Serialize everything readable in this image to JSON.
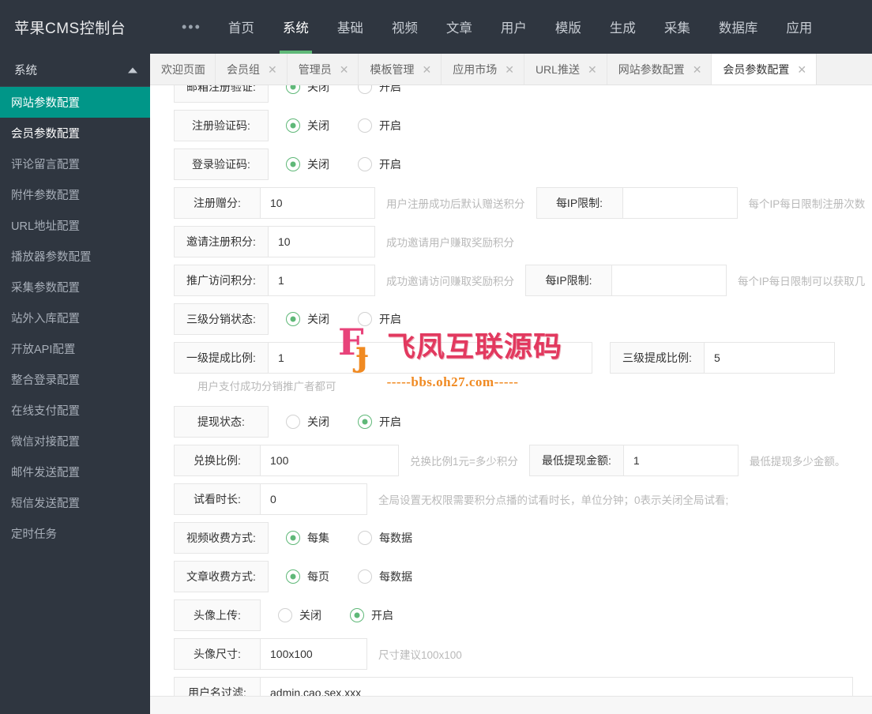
{
  "header": {
    "brand": "苹果CMS控制台",
    "dots": "•••",
    "nav": [
      {
        "label": "首页",
        "active": false
      },
      {
        "label": "系统",
        "active": true
      },
      {
        "label": "基础",
        "active": false
      },
      {
        "label": "视频",
        "active": false
      },
      {
        "label": "文章",
        "active": false
      },
      {
        "label": "用户",
        "active": false
      },
      {
        "label": "模版",
        "active": false
      },
      {
        "label": "生成",
        "active": false
      },
      {
        "label": "采集",
        "active": false
      },
      {
        "label": "数据库",
        "active": false
      },
      {
        "label": "应用",
        "active": false
      }
    ]
  },
  "sidebar": {
    "group_label": "系统",
    "items": [
      {
        "label": "网站参数配置",
        "active": true
      },
      {
        "label": "会员参数配置",
        "active": false,
        "hovered": true
      },
      {
        "label": "评论留言配置",
        "active": false
      },
      {
        "label": "附件参数配置",
        "active": false
      },
      {
        "label": "URL地址配置",
        "active": false
      },
      {
        "label": "播放器参数配置",
        "active": false
      },
      {
        "label": "采集参数配置",
        "active": false
      },
      {
        "label": "站外入库配置",
        "active": false
      },
      {
        "label": "开放API配置",
        "active": false
      },
      {
        "label": "整合登录配置",
        "active": false
      },
      {
        "label": "在线支付配置",
        "active": false
      },
      {
        "label": "微信对接配置",
        "active": false
      },
      {
        "label": "邮件发送配置",
        "active": false
      },
      {
        "label": "短信发送配置",
        "active": false
      },
      {
        "label": "定时任务",
        "active": false
      }
    ]
  },
  "tabs": [
    {
      "label": "欢迎页面",
      "closable": false,
      "active": false
    },
    {
      "label": "会员组",
      "closable": true,
      "active": false
    },
    {
      "label": "管理员",
      "closable": true,
      "active": false
    },
    {
      "label": "模板管理",
      "closable": true,
      "active": false
    },
    {
      "label": "应用市场",
      "closable": true,
      "active": false
    },
    {
      "label": "URL推送",
      "closable": true,
      "active": false
    },
    {
      "label": "网站参数配置",
      "closable": true,
      "active": false
    },
    {
      "label": "会员参数配置",
      "closable": true,
      "active": true
    }
  ],
  "tab_close_glyph": "✕",
  "form": {
    "row_email_verify": {
      "label": "邮箱注册验证:",
      "off_label": "关闭",
      "on_label": "开启",
      "value": "off"
    },
    "row_reg_captcha": {
      "label": "注册验证码:",
      "off_label": "关闭",
      "on_label": "开启",
      "value": "off"
    },
    "row_login_captcha": {
      "label": "登录验证码:",
      "off_label": "关闭",
      "on_label": "开启",
      "value": "off"
    },
    "row_reg_points": {
      "label": "注册赠分:",
      "value": "10",
      "hint": "用户注册成功后默认赠送积分",
      "ip_label": "每IP限制:",
      "ip_value": "",
      "ip_hint": "每个IP每日限制注册次数"
    },
    "row_invite_points": {
      "label": "邀请注册积分:",
      "value": "10",
      "hint": "成功邀请用户赚取奖励积分"
    },
    "row_promote_points": {
      "label": "推广访问积分:",
      "value": "1",
      "hint": "成功邀请访问赚取奖励积分",
      "ip_label": "每IP限制:",
      "ip_value": "",
      "ip_hint": "每个IP每日限制可以获取几"
    },
    "row_distribution": {
      "label": "三级分销状态:",
      "off_label": "关闭",
      "on_label": "开启",
      "value": "off"
    },
    "row_commission": {
      "l1_label": "一级提成比例:",
      "l1_value": "1",
      "l3_label": "三级提成比例:",
      "l3_value": "5",
      "hint": "用户支付成功分销推广者都可"
    },
    "row_withdraw_status": {
      "label": "提现状态:",
      "off_label": "关闭",
      "on_label": "开启",
      "value": "on"
    },
    "row_exchange": {
      "label": "兑换比例:",
      "value": "100",
      "hint": "兑换比例1元=多少积分",
      "min_label": "最低提现金额:",
      "min_value": "1",
      "min_hint": "最低提现多少金额。"
    },
    "row_preview": {
      "label": "试看时长:",
      "value": "0",
      "hint": "全局设置无权限需要积分点播的试看时长，单位分钟；0表示关闭全局试看;"
    },
    "row_video_fee": {
      "label": "视频收费方式:",
      "opt1_label": "每集",
      "opt2_label": "每数据",
      "value": "opt1"
    },
    "row_article_fee": {
      "label": "文章收费方式:",
      "opt1_label": "每页",
      "opt2_label": "每数据",
      "value": "opt1"
    },
    "row_avatar_upload": {
      "label": "头像上传:",
      "off_label": "关闭",
      "on_label": "开启",
      "value": "on"
    },
    "row_avatar_size": {
      "label": "头像尺寸:",
      "value": "100x100",
      "hint": "尺寸建议100x100"
    },
    "row_username_filter": {
      "label": "用户名过滤:",
      "value": "admin,cao,sex,xxx"
    }
  },
  "watermark": {
    "logo_f": "F",
    "logo_j": "ɟ",
    "text": "飞凤互联源码",
    "url": "-----bbs.oh27.com-----"
  },
  "colors": {
    "header_bg": "#2f3640",
    "nav_active_underline": "#5fb878",
    "sidebar_active_bg": "#009688",
    "radio_on": "#5fb878",
    "hint_text": "#b9b9b9",
    "watermark_pink": "#e2395f",
    "watermark_orange": "#f08a22"
  }
}
